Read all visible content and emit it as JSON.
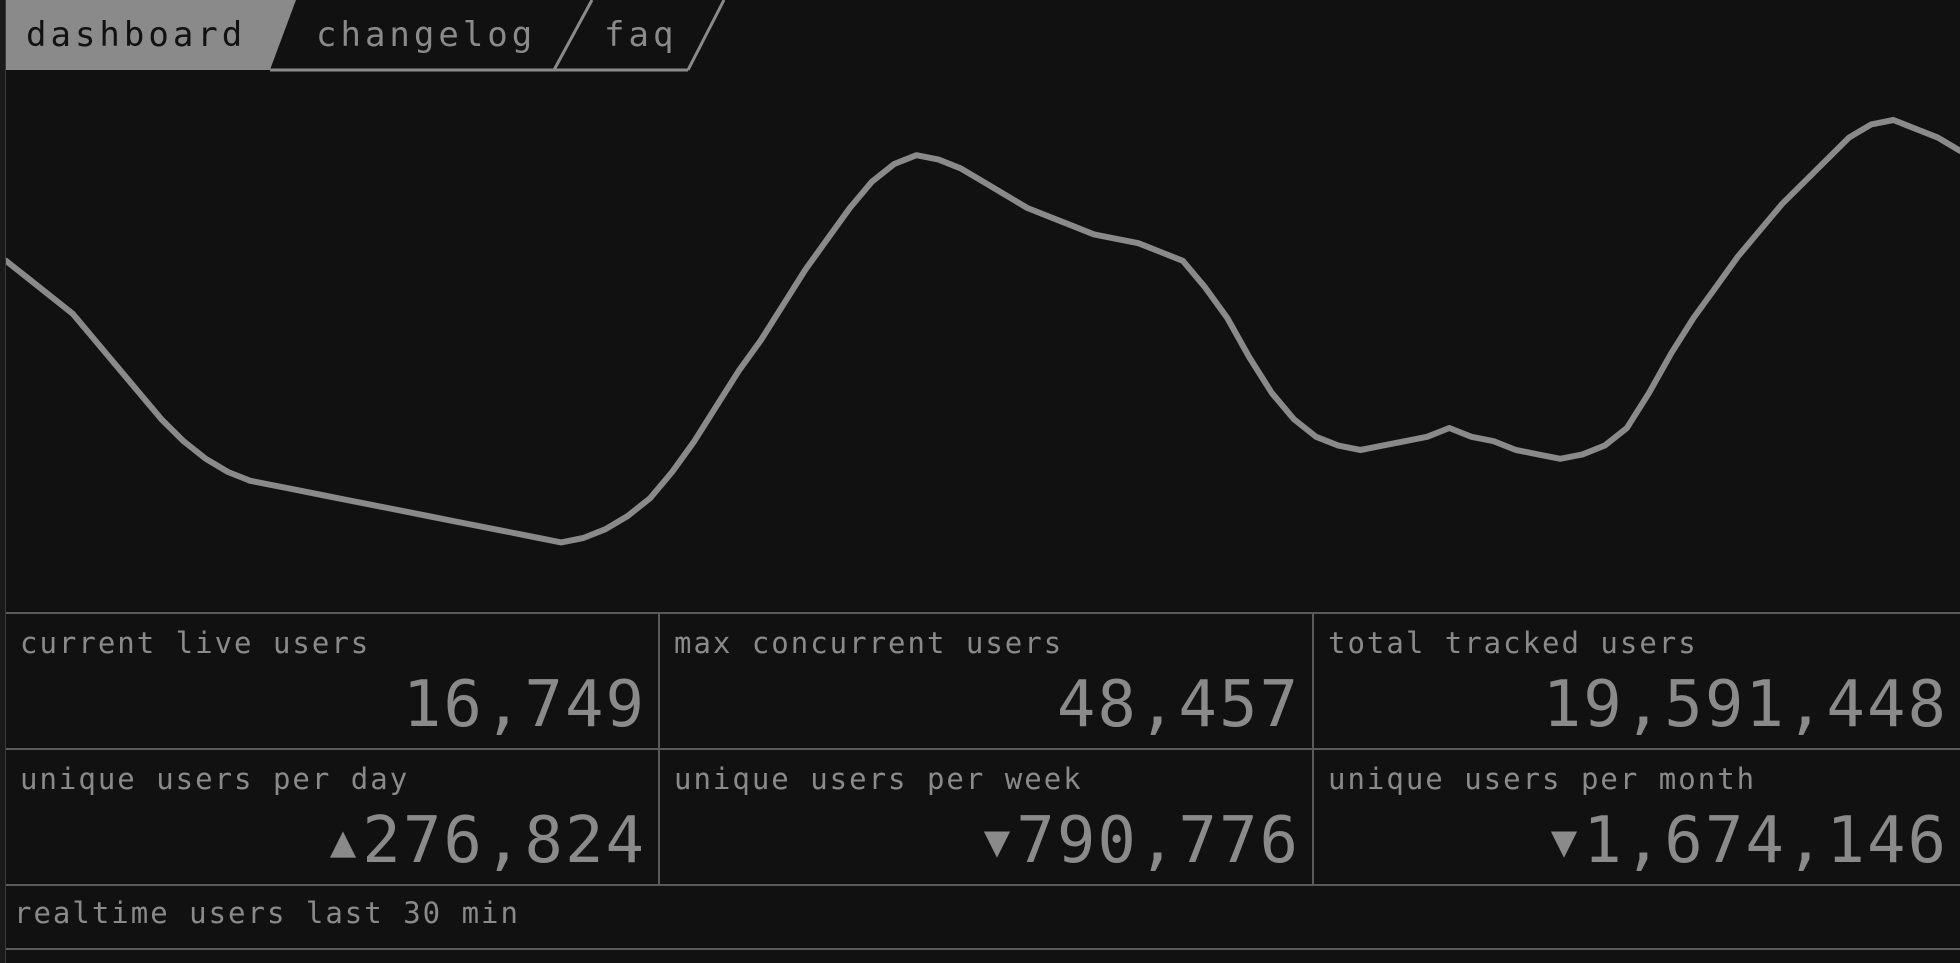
{
  "tabs": [
    {
      "label": "dashboard",
      "active": true
    },
    {
      "label": "changelog",
      "active": false
    },
    {
      "label": "faq",
      "active": false
    }
  ],
  "colors": {
    "background": "#111111",
    "foreground": "#8a8a8a",
    "border": "#5a5a5a"
  },
  "stats": {
    "current_live_users": {
      "label": "current live users",
      "value": "16,749"
    },
    "max_concurrent_users": {
      "label": "max concurrent users",
      "value": "48,457"
    },
    "total_tracked_users": {
      "label": "total tracked users",
      "value": "19,591,448"
    },
    "unique_per_day": {
      "label": "unique users per day",
      "value": "276,824",
      "trend": "▲"
    },
    "unique_per_week": {
      "label": "unique users per week",
      "value": "790,776",
      "trend": "▼"
    },
    "unique_per_month": {
      "label": "unique users per month",
      "value": "1,674,146",
      "trend": "▼"
    }
  },
  "realtime_section": {
    "label": "realtime users last 30 min"
  },
  "chart_data": {
    "type": "line",
    "title": "",
    "xlabel": "",
    "ylabel": "",
    "grid": false,
    "series": [
      {
        "values": [
          0.68,
          0.64,
          0.6,
          0.56,
          0.5,
          0.44,
          0.38,
          0.32,
          0.27,
          0.23,
          0.2,
          0.18,
          0.17,
          0.16,
          0.15,
          0.14,
          0.13,
          0.12,
          0.11,
          0.1,
          0.09,
          0.08,
          0.07,
          0.06,
          0.05,
          0.04,
          0.05,
          0.07,
          0.1,
          0.14,
          0.2,
          0.27,
          0.35,
          0.43,
          0.5,
          0.58,
          0.66,
          0.73,
          0.8,
          0.86,
          0.9,
          0.92,
          0.91,
          0.89,
          0.86,
          0.83,
          0.8,
          0.78,
          0.76,
          0.74,
          0.73,
          0.72,
          0.7,
          0.68,
          0.62,
          0.55,
          0.46,
          0.38,
          0.32,
          0.28,
          0.26,
          0.25,
          0.26,
          0.27,
          0.28,
          0.3,
          0.28,
          0.27,
          0.25,
          0.24,
          0.23,
          0.24,
          0.26,
          0.3,
          0.38,
          0.47,
          0.55,
          0.62,
          0.69,
          0.75,
          0.81,
          0.86,
          0.91,
          0.96,
          0.99,
          1.0,
          0.98,
          0.96,
          0.93
        ]
      }
    ]
  }
}
